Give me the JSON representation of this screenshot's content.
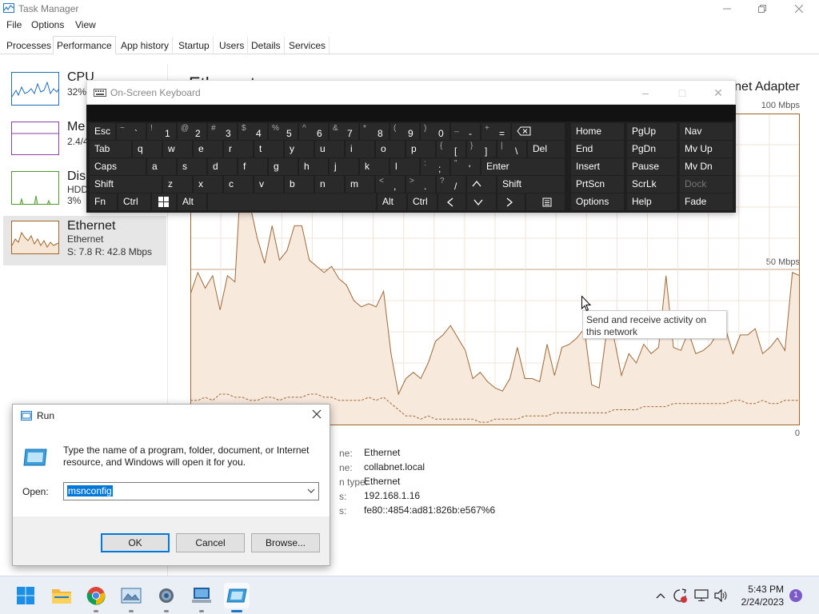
{
  "taskmanager": {
    "title": "Task Manager",
    "menu": [
      "File",
      "Options",
      "View"
    ],
    "tabs": [
      "Processes",
      "Performance",
      "App history",
      "Startup",
      "Users",
      "Details",
      "Services"
    ],
    "sidebar": [
      {
        "name": "CPU",
        "sub1": "32%",
        "sub2": ""
      },
      {
        "name": "Me",
        "sub1": "2.4/4",
        "sub2": ""
      },
      {
        "name": "Dis",
        "sub1": "HDD",
        "sub2": "3%"
      },
      {
        "name": "Ethernet",
        "sub1": "Ethernet",
        "sub2": "S: 7.8 R: 42.8 Mbps"
      }
    ],
    "main_title": "Ethernet",
    "adapter": "net Adapter",
    "chart_max": "100 Mbps",
    "chart_mid": "50 Mbps",
    "chart_min": "0",
    "info": {
      "labels": [
        "ne:",
        "ne:",
        "n type:",
        "s:",
        "s:"
      ],
      "values": [
        "Ethernet",
        "collabnet.local",
        "Ethernet",
        "192.168.1.16",
        "fe80::4854:ad81:826b:e567%6"
      ]
    },
    "tooltip": "Send and receive activity on this network"
  },
  "osk": {
    "title": "On-Screen Keyboard",
    "row1": [
      {
        "up": "~",
        "lo": "`"
      },
      {
        "up": "!",
        "lo": "1"
      },
      {
        "up": "@",
        "lo": "2"
      },
      {
        "up": "#",
        "lo": "3"
      },
      {
        "up": "$",
        "lo": "4"
      },
      {
        "up": "%",
        "lo": "5"
      },
      {
        "up": "^",
        "lo": "6"
      },
      {
        "up": "&",
        "lo": "7"
      },
      {
        "up": "*",
        "lo": "8"
      },
      {
        "up": "(",
        "lo": "9"
      },
      {
        "up": ")",
        "lo": "0"
      },
      {
        "up": "_",
        "lo": "-"
      },
      {
        "up": "+",
        "lo": "="
      }
    ],
    "row2": [
      "q",
      "w",
      "e",
      "r",
      "t",
      "y",
      "u",
      "i",
      "o",
      "p"
    ],
    "row2_sym": [
      {
        "up": "{",
        "lo": "["
      },
      {
        "up": "}",
        "lo": "]"
      },
      {
        "up": "|",
        "lo": "\\"
      }
    ],
    "row3": [
      "a",
      "s",
      "d",
      "f",
      "g",
      "h",
      "j",
      "k",
      "l"
    ],
    "row3_sym": [
      {
        "up": ":",
        "lo": ";"
      },
      {
        "up": "\"",
        "lo": "'"
      }
    ],
    "row4": [
      "z",
      "x",
      "c",
      "v",
      "b",
      "n",
      "m"
    ],
    "row4_sym": [
      {
        "up": "<",
        "lo": ","
      },
      {
        "up": ">",
        "lo": "."
      },
      {
        "up": "?",
        "lo": "/"
      }
    ],
    "labels": {
      "esc": "Esc",
      "tab": "Tab",
      "caps": "Caps",
      "shift": "Shift",
      "fn": "Fn",
      "ctrl": "Ctrl",
      "alt": "Alt",
      "del": "Del",
      "enter": "Enter",
      "shift_r": "Shift",
      "alt_r": "Alt",
      "ctrl_r": "Ctrl"
    },
    "nav": [
      [
        "Home",
        "PgUp",
        "Nav"
      ],
      [
        "End",
        "PgDn",
        "Mv Up"
      ],
      [
        "Insert",
        "Pause",
        "Mv Dn"
      ],
      [
        "PrtScn",
        "ScrLk",
        "Dock"
      ],
      [
        "Options",
        "Help",
        "Fade"
      ]
    ]
  },
  "run": {
    "title": "Run",
    "description": "Type the name of a program, folder, document, or Internet resource, and Windows will open it for you.",
    "open_label": "Open:",
    "input_value": "msnconfig",
    "ok": "OK",
    "cancel": "Cancel",
    "browse": "Browse..."
  },
  "taskbar": {
    "time": "5:43 PM",
    "date": "2/24/2023",
    "notifications": "1"
  },
  "chart_data": {
    "type": "line",
    "ylim": [
      0,
      100
    ],
    "receive": [
      42,
      49,
      44,
      48,
      37,
      48,
      46,
      88,
      71,
      60,
      52,
      64,
      53,
      56,
      64,
      64,
      53,
      51,
      49,
      51,
      47,
      45,
      40,
      38,
      39,
      38,
      43,
      23,
      10,
      15,
      17,
      15,
      20,
      27,
      29,
      32,
      28,
      24,
      15,
      17,
      14,
      12,
      11,
      15,
      25,
      15,
      15,
      14,
      26,
      16,
      25,
      26,
      28,
      31,
      13,
      12,
      30,
      28,
      16,
      23,
      20,
      26,
      23,
      25,
      48,
      25,
      24,
      30,
      23,
      24,
      26,
      30,
      31,
      23,
      29,
      29,
      31,
      23,
      25,
      28,
      24,
      49,
      48
    ],
    "send": [
      8,
      8,
      9,
      8,
      10,
      10,
      9,
      9,
      8,
      8,
      9,
      9,
      8,
      9,
      9,
      9,
      10,
      10,
      9,
      9,
      8,
      8,
      8,
      8,
      9,
      8,
      9,
      7,
      5,
      3,
      3,
      2,
      3,
      2,
      2,
      2,
      2,
      2,
      2,
      1,
      1,
      2,
      2,
      2,
      2,
      3,
      3,
      3,
      3,
      4,
      4,
      4,
      4,
      4,
      4,
      4,
      4,
      5,
      5,
      5,
      5,
      6,
      6,
      6,
      6,
      7,
      7,
      7,
      7,
      7,
      7,
      7,
      7,
      8,
      8,
      7,
      7,
      8,
      7,
      7,
      8,
      8,
      8
    ]
  }
}
